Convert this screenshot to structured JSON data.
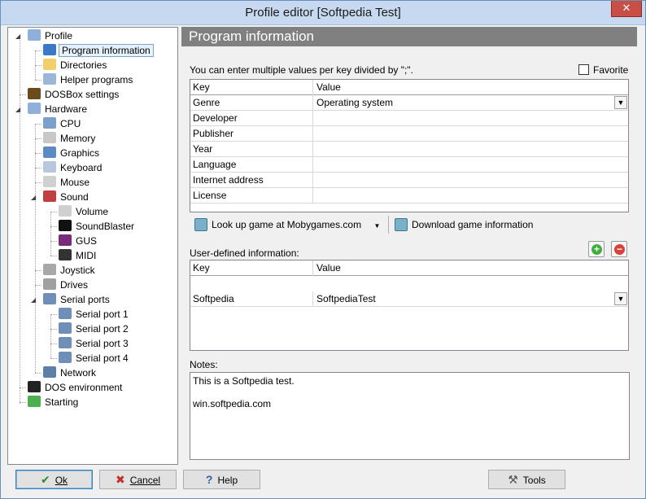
{
  "window": {
    "title": "Profile editor [Softpedia Test]",
    "close_glyph": "✕"
  },
  "tree": {
    "items": [
      {
        "label": "Profile",
        "icon": "profile-icon",
        "color": "#8fb0d8"
      },
      {
        "label": "Program information",
        "icon": "info-icon",
        "color": "#3a78c8"
      },
      {
        "label": "Directories",
        "icon": "folder-icon",
        "color": "#f2cf6b"
      },
      {
        "label": "Helper programs",
        "icon": "helper-icon",
        "color": "#9bb6d6"
      },
      {
        "label": "DOSBox settings",
        "icon": "dosbox-icon",
        "color": "#6b4a1c"
      },
      {
        "label": "Hardware",
        "icon": "hardware-icon",
        "color": "#8fb0d8"
      },
      {
        "label": "CPU",
        "icon": "cpu-icon",
        "color": "#7ca0cc"
      },
      {
        "label": "Memory",
        "icon": "memory-icon",
        "color": "#c8c8c8"
      },
      {
        "label": "Graphics",
        "icon": "graphics-icon",
        "color": "#5d8ac4"
      },
      {
        "label": "Keyboard",
        "icon": "keyboard-icon",
        "color": "#b8c8dc"
      },
      {
        "label": "Mouse",
        "icon": "mouse-icon",
        "color": "#d0d0d0"
      },
      {
        "label": "Sound",
        "icon": "sound-icon",
        "color": "#c04040"
      },
      {
        "label": "Volume",
        "icon": "volume-icon",
        "color": "#cfcfcf"
      },
      {
        "label": "SoundBlaster",
        "icon": "soundblaster-icon",
        "color": "#111111"
      },
      {
        "label": "GUS",
        "icon": "gus-icon",
        "color": "#7a2a7a"
      },
      {
        "label": "MIDI",
        "icon": "midi-icon",
        "color": "#333333"
      },
      {
        "label": "Joystick",
        "icon": "joystick-icon",
        "color": "#a8a8a8"
      },
      {
        "label": "Drives",
        "icon": "drives-icon",
        "color": "#a0a0a0"
      },
      {
        "label": "Serial ports",
        "icon": "serial-ports-icon",
        "color": "#6f8fb8"
      },
      {
        "label": "Serial port 1",
        "icon": "serial-port-icon",
        "color": "#6f8fb8"
      },
      {
        "label": "Serial port 2",
        "icon": "serial-port-icon",
        "color": "#6f8fb8"
      },
      {
        "label": "Serial port 3",
        "icon": "serial-port-icon",
        "color": "#6f8fb8"
      },
      {
        "label": "Serial port 4",
        "icon": "serial-port-icon",
        "color": "#6f8fb8"
      },
      {
        "label": "Network",
        "icon": "network-icon",
        "color": "#5d7fa8"
      },
      {
        "label": "DOS environment",
        "icon": "dos-environment-icon",
        "color": "#222222"
      },
      {
        "label": "Starting",
        "icon": "starting-icon",
        "color": "#4caf50"
      }
    ]
  },
  "main": {
    "header": "Program information",
    "hint": "You can enter multiple values per key divided by \";\".",
    "favorite_label": "Favorite",
    "grid": {
      "col_key": "Key",
      "col_value": "Value",
      "rows": [
        {
          "key": "Genre",
          "value": "Operating system"
        },
        {
          "key": "Developer",
          "value": ""
        },
        {
          "key": "Publisher",
          "value": ""
        },
        {
          "key": "Year",
          "value": ""
        },
        {
          "key": "Language",
          "value": ""
        },
        {
          "key": "Internet address",
          "value": ""
        },
        {
          "key": "License",
          "value": ""
        }
      ]
    },
    "lookup_label": "Look up game at Mobygames.com",
    "download_label": "Download game information",
    "user_defined_label": "User-defined information:",
    "user_grid": {
      "col_key": "Key",
      "col_value": "Value",
      "rows": [
        {
          "key": "Softpedia",
          "value": "SoftpediaTest"
        }
      ]
    },
    "notes_label": "Notes:",
    "notes_lines": [
      "This is a Softpedia test.",
      "",
      "win.softpedia.com"
    ]
  },
  "buttons": {
    "ok_label": "Ok",
    "cancel_label": "Cancel",
    "help_label": "Help",
    "tools_label": "Tools"
  },
  "colors": {
    "header_bg": "#808080",
    "add": "#3fae3f",
    "remove": "#d9423a"
  }
}
